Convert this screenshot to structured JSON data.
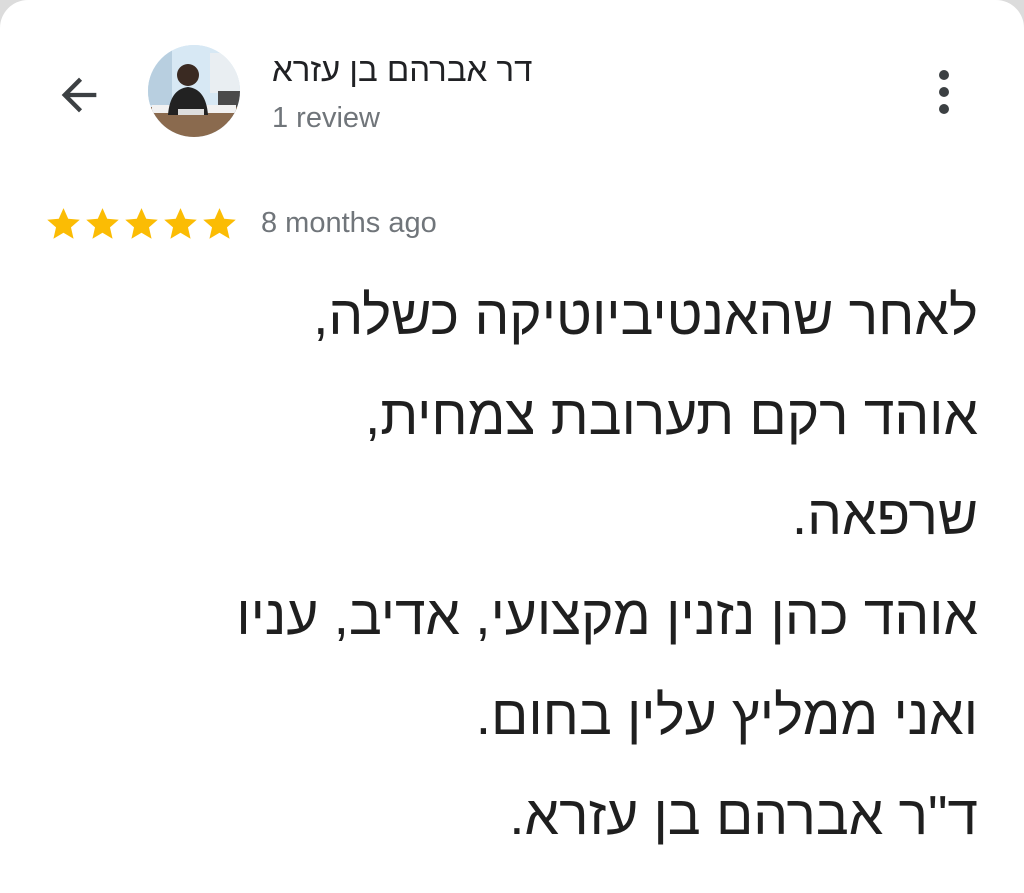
{
  "header": {
    "back_icon": "arrow-left-icon",
    "reviewer_name": "דר אברהם בן עזרא",
    "review_count": "1 review",
    "more_icon": "more-vert-icon"
  },
  "review": {
    "rating": 5,
    "max_rating": 5,
    "star_color": "#fbbc04",
    "date": "8 months ago",
    "lines": [
      "לאחר שהאנטיביוטיקה כשלה,",
      "אוהד רקם תערובת צמחית,",
      "שרפאה.",
      "אוהד כהן נזנין מקצועי, אדיב, עניו",
      "ואני ממליץ עלין בחום.",
      "ד\"ר אברהם בן עזרא."
    ]
  }
}
